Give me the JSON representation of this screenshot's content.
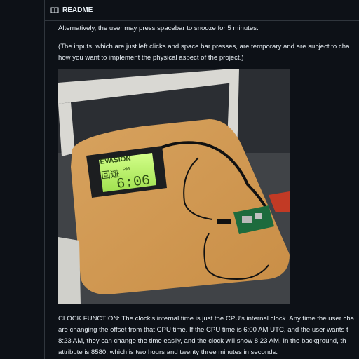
{
  "readme": {
    "title": "README",
    "paragraphs": [
      [
        "Alternatively, the user may press spacebar to snooze for 5 minutes."
      ],
      [
        "(The inputs, which are just left clicks and space bar presses, are temporary and are subject to cha",
        "how you want to implement the physical aspect of the project.)"
      ],
      [
        "CLOCK FUNCTION: The clock's internal time is just the CPU's internal clock. Any time the user cha",
        "are changing the offset from that CPU time. If the CPU time is 6:00 AM UTC, and the user wants t",
        "8:23 AM, they can change the time easily, and the clock will show 8:23 AM. In the background, th",
        "attribute is 8580, which is two hours and twenty three minutes in seconds."
      ]
    ]
  },
  "photo": {
    "screen_brand": "EVASION",
    "screen_kanji": "回遊",
    "screen_ampm": "PM",
    "screen_time": "6:06"
  },
  "colors": {
    "background": "#0d1117",
    "text": "#e6edf3",
    "border": "#30363d",
    "lcd_green": "#b9f26a"
  }
}
